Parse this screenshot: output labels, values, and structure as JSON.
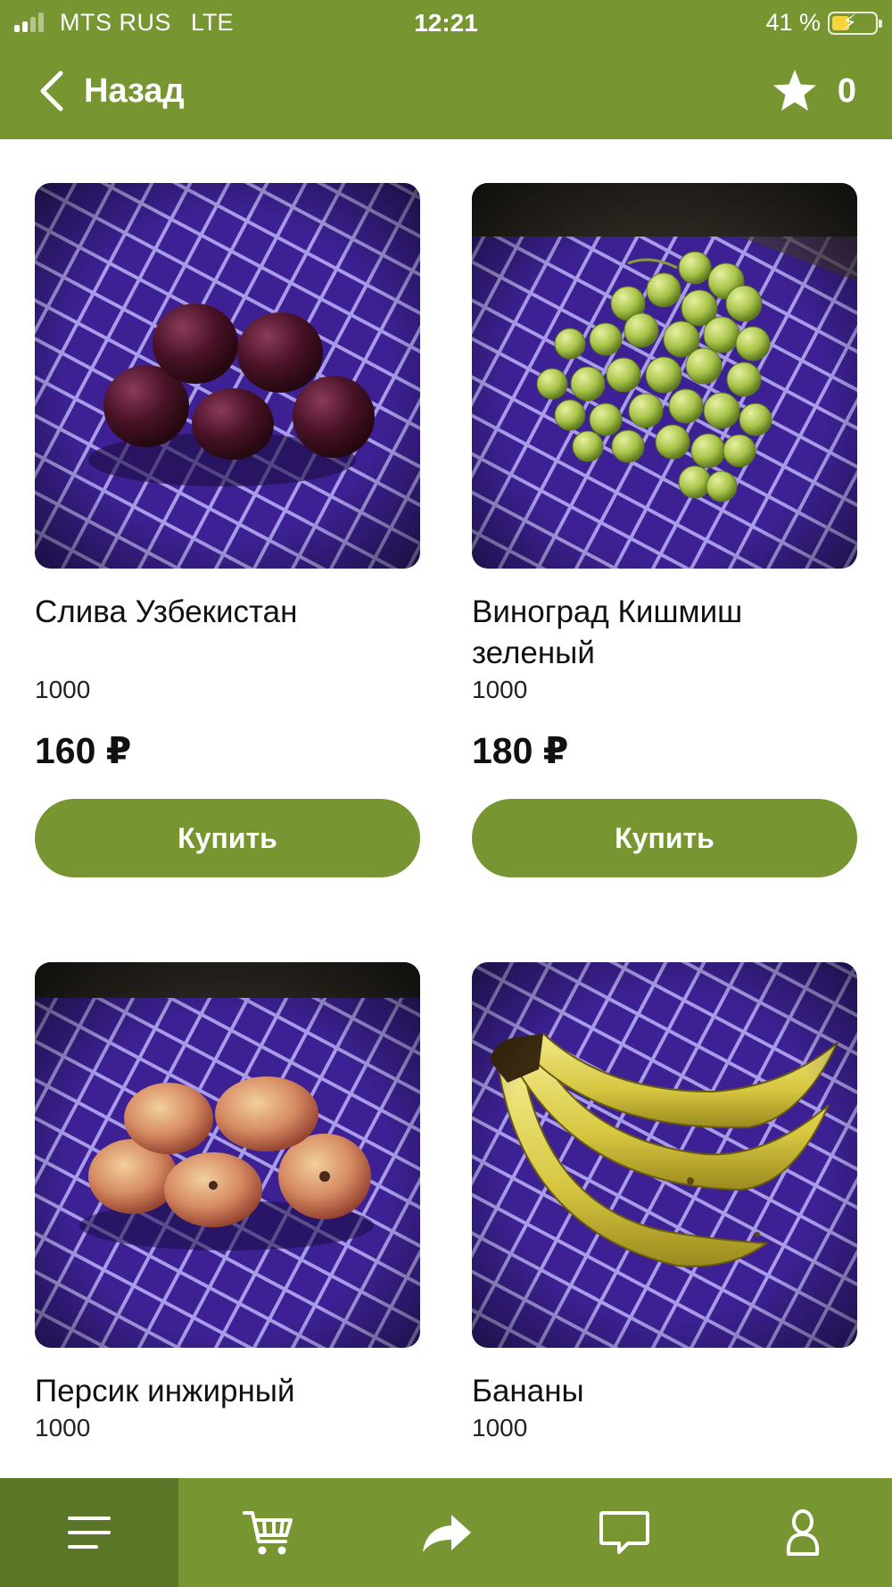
{
  "status_bar": {
    "carrier": "MTS RUS",
    "network": "LTE",
    "time": "12:21",
    "battery_percent": "41 %",
    "battery_level": 0.41
  },
  "nav": {
    "back_label": "Назад",
    "favorites_count": "0"
  },
  "products": [
    {
      "name": "Слива Узбекистан",
      "weight": "1000",
      "price": "160 ₽",
      "buy_label": "Купить",
      "image": "plums-photo"
    },
    {
      "name": "Виноград Кишмиш зеленый",
      "weight": "1000",
      "price": "180 ₽",
      "buy_label": "Купить",
      "image": "grapes-photo"
    },
    {
      "name": "Персик инжирный",
      "weight": "1000",
      "image": "peaches-photo"
    },
    {
      "name": "Бананы",
      "weight": "1000",
      "image": "bananas-photo"
    }
  ],
  "tabbar": {
    "items": [
      {
        "icon": "menu-icon",
        "active": true
      },
      {
        "icon": "cart-icon",
        "active": false
      },
      {
        "icon": "share-icon",
        "active": false
      },
      {
        "icon": "chat-icon",
        "active": false
      },
      {
        "icon": "profile-icon",
        "active": false
      }
    ]
  },
  "colors": {
    "brand_green": "#779631",
    "active_tab": "#5a7626",
    "tablecloth": "#3b1f8c"
  }
}
